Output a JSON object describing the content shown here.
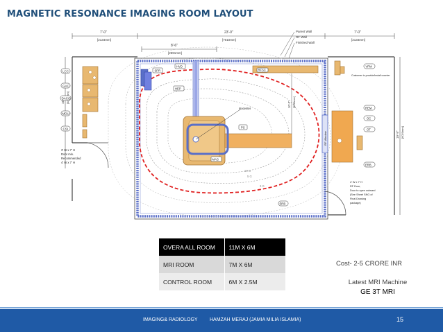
{
  "slide": {
    "title": "MAGNETIC RESONANCE IMAGING ROOM LAYOUT"
  },
  "plan": {
    "dimensions": {
      "left_ft": "7'-0\"",
      "left_mm": "[2134mm]",
      "mid_ft": "8'-6\"",
      "mid_mm": "[2591mm]",
      "center_ft": "23'-0\"",
      "center_mm": "[7010mm]",
      "right_ft": "7'-0\"",
      "right_mm": "[2134mm]",
      "left_vertical": "16'-0\"",
      "left_vertical_mm": "[4876mm]",
      "right_vertical": "19'-9\"",
      "right_vertical_mm": "[6020mm]",
      "center_vertical": "10'-2\"",
      "center_vertical_mm": "[3098mm]"
    },
    "wall_labels": {
      "parent_wall": "Parent Wall",
      "rf_wall": "RF Wall",
      "finished_wall": "Finished Wall"
    },
    "labels": {
      "spr": "SPR",
      "hvd": "HVD",
      "hep": "HEP",
      "rfsc": "RFSC",
      "isocenter": "Isocenter",
      "ps": "PS",
      "mag": "MAG",
      "lcc": "LCC",
      "gac": "GAC",
      "dacq": "DACQ",
      "mdu": "MDU",
      "csi": "CSI",
      "vpm": "VPM",
      "rem": "REM",
      "oc": "OC",
      "ot": "OT",
      "erb": "ERB",
      "rf_window": "RF Window",
      "customer_note": "Customer to provide/install counter",
      "door_left_1": "3' W x 7' H",
      "door_left_2": "Door min.",
      "door_left_3": "Recommended",
      "door_left_4": "4' W x 7' H",
      "door_right_1": "4' W x 7' H",
      "door_right_2": "RF Door,",
      "door_right_3": "Door to open outward",
      "door_right_4": "(See Sheet SNG of",
      "door_right_5": "Final Drawing",
      "door_right_6": "package)",
      "gauss_10": "10 G",
      "gauss_5": "5 G",
      "gauss_3": "3 G"
    },
    "colors": {
      "wall_blue": "#5a6fc8",
      "gauss_red": "#e02020",
      "equipment_tan": "#e8b870",
      "equipment_orange": "#f0a850",
      "hvd_blue": "#7080e0"
    }
  },
  "specs": {
    "rows": [
      {
        "label": "OVERA ALL ROOM",
        "value": "11M X 6M"
      },
      {
        "label": "MRI ROOM",
        "value": "7M X 6M"
      },
      {
        "label": "CONTROL ROOM",
        "value": "6M X 2.5M"
      }
    ]
  },
  "cost": {
    "text": "Cost- 2-5 CRORE INR"
  },
  "machine": {
    "heading": "Latest MRI Machine",
    "model": "GE 3T MRI"
  },
  "footer": {
    "department": "IMAGING& RADIOLOGY",
    "author": "HAMZAH MERAJ (JAMIA MILIA ISLAMIA)",
    "page": "15"
  }
}
